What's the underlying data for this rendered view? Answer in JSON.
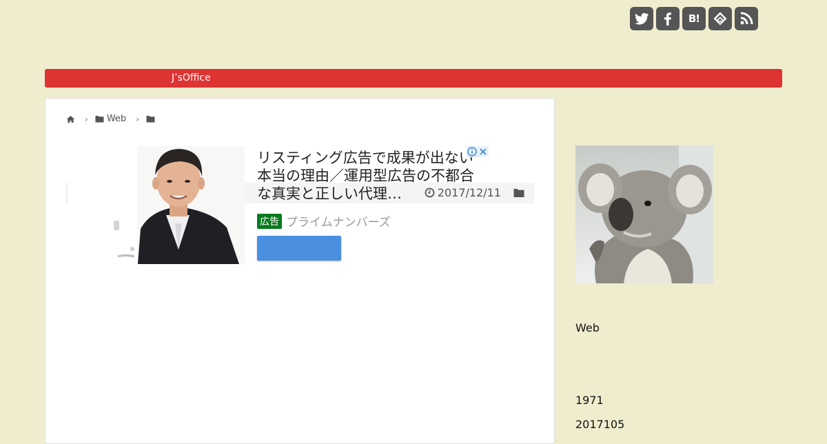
{
  "social": {
    "icons": [
      "twitter-icon",
      "facebook-icon",
      "hatena-bookmark-icon",
      "feedly-icon",
      "rss-icon"
    ],
    "hatena_label": "B!"
  },
  "nav": {
    "site_name": "J’sOffice",
    "bar_color": "#dd3333"
  },
  "breadcrumb": {
    "home_icon": "home-icon",
    "category": "Web"
  },
  "post": {
    "date": "2017/12/11"
  },
  "ad": {
    "headline": "リスティング広告で成果が出ない本当の理由／運用型広告の不都合な真実と正しい代理…",
    "badge": "広告",
    "advertiser": "プライムナンバーズ",
    "cta_color": "#4a8fe0"
  },
  "sidebar": {
    "category": "Web",
    "year": "1971",
    "date_code": "2017105"
  }
}
